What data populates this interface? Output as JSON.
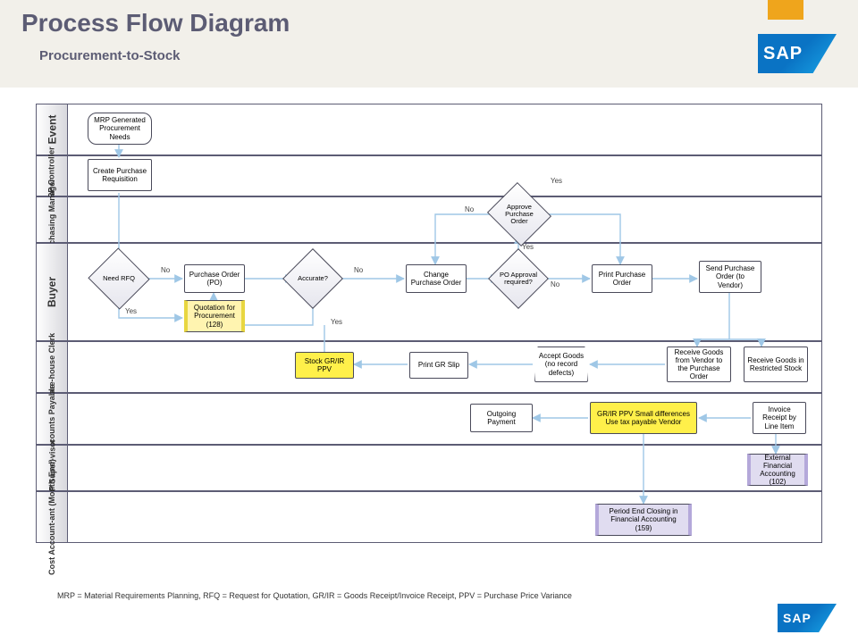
{
  "header": {
    "title": "Process Flow Diagram",
    "subtitle": "Procurement-to-Stock",
    "logo": "SAP"
  },
  "lanes": {
    "event": "Event",
    "mrp": "MRP Controller",
    "purmgr": "Pur-chasing Manager",
    "buyer": "Buyer",
    "wh": "Ware-house Clerk",
    "ap": "Accounts Payable",
    "apsup": "AP Super-visor",
    "cost": "Cost Account-ant (Month End)"
  },
  "nodes": {
    "n1": "MRP Generated Procurement Needs",
    "n2": "Create Purchase Requisition",
    "d_rfq": "Need RFQ",
    "n_po": "Purchase Order (PO)",
    "n_quote": "Quotation for Procurement (128)",
    "d_acc": "Accurate?",
    "n_change": "Change Purchase Order",
    "d_poreq": "PO Approval required?",
    "d_approve": "Approve Purchase Order",
    "n_print": "Print Purchase Order",
    "n_send": "Send Purchase Order (to Vendor)",
    "n_stock": "Stock GR/IR PPV",
    "n_prslip": "Print GR Slip",
    "n_inspect": "Accept Goods (no record defects)",
    "n_recv1": "Receive Goods from Vendor to the Purchase Order",
    "n_recv2": "Receive Goods in Restricted Stock",
    "n_out": "Outgoing Payment",
    "n_grir": "GR/IR PPV Small differences Use tax payable Vendor",
    "n_inv": "Invoice Receipt by Line Item",
    "n_ext": "External Financial Accounting (102)",
    "n_pend": "Period End Closing in Financial Accounting (159)"
  },
  "labels": {
    "yes": "Yes",
    "no": "No"
  },
  "footer": "MRP = Material Requirements Planning, RFQ = Request for Quotation, GR/IR = Goods Receipt/Invoice Receipt, PPV = Purchase Price Variance"
}
